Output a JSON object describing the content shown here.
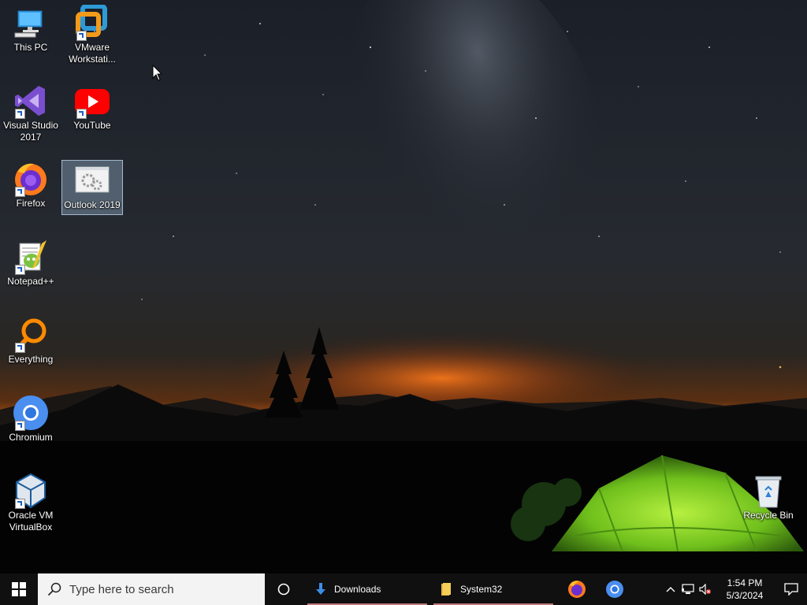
{
  "desktop": {
    "icons_left": [
      {
        "label": "This PC",
        "icon": "this-pc-icon"
      },
      {
        "label": "VMware Workstati...",
        "icon": "vmware-icon"
      },
      {
        "label": "Visual Studio 2017",
        "icon": "visual-studio-icon"
      },
      {
        "label": "YouTube",
        "icon": "youtube-icon"
      },
      {
        "label": "Firefox",
        "icon": "firefox-icon"
      },
      {
        "label": "Outlook 2019",
        "icon": "outlook-icon",
        "selected": true
      },
      {
        "label": "Notepad++",
        "icon": "notepad-plus-plus-icon"
      },
      {
        "label": "Everything",
        "icon": "everything-icon"
      },
      {
        "label": "Chromium",
        "icon": "chromium-icon"
      },
      {
        "label": "Oracle VM VirtualBox",
        "icon": "virtualbox-icon"
      }
    ],
    "recycle_bin": {
      "label": "Recycle Bin",
      "icon": "recycle-bin-icon"
    }
  },
  "taskbar": {
    "search_placeholder": "Type here to search",
    "apps": [
      {
        "label": "Downloads",
        "icon": "downloads-folder-icon"
      },
      {
        "label": "System32",
        "icon": "folder-icon"
      }
    ],
    "pinned": [
      {
        "name": "firefox",
        "icon": "firefox-icon"
      },
      {
        "name": "chromium",
        "icon": "chromium-icon"
      }
    ],
    "tray": {
      "icons": [
        "chevron-up-icon",
        "network-icon",
        "volume-muted-icon"
      ],
      "time": "1:54 PM",
      "date": "5/3/2024"
    }
  },
  "colors": {
    "taskbar": "#101010",
    "search_box": "#f3f3f3",
    "app_underline": "#c0787a",
    "tent": "#8fdc2a"
  }
}
